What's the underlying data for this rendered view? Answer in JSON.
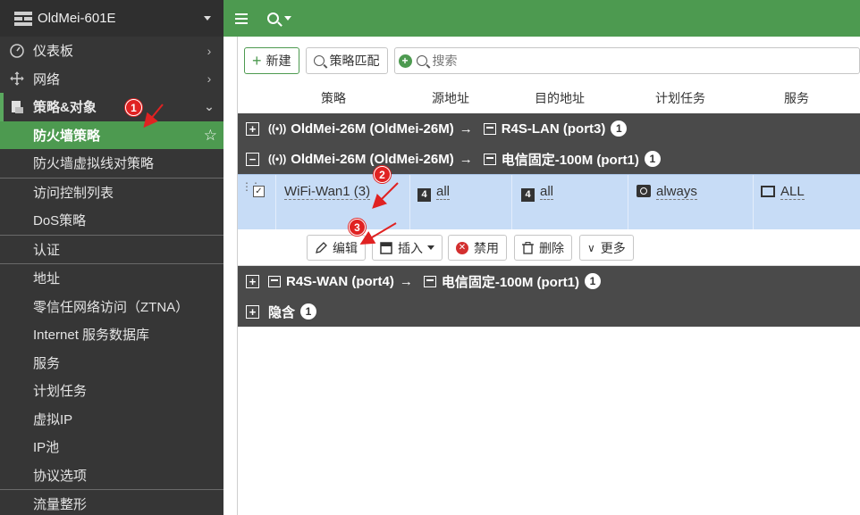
{
  "device": {
    "name": "OldMei-601E"
  },
  "sidebar": {
    "items": [
      {
        "label": "仪表板",
        "icon": "dashboard-icon"
      },
      {
        "label": "网络",
        "icon": "network-move-icon"
      },
      {
        "label": "策略&对象",
        "icon": "policy-icon"
      }
    ],
    "sub_items": [
      "防火墙策略",
      "防火墙虚拟线对策略",
      "访问控制列表",
      "DoS策略",
      "认证",
      "地址",
      "零信任网络访问（ZTNA）",
      "Internet 服务数据库",
      "服务",
      "计划任务",
      "虚拟IP",
      "IP池",
      "协议选项",
      "流量整形"
    ]
  },
  "toolbar": {
    "new_label": "新建",
    "policy_match_label": "策略匹配",
    "search_placeholder": "搜索"
  },
  "columns": [
    "策略",
    "源地址",
    "目的地址",
    "计划任务",
    "服务"
  ],
  "groups": [
    {
      "expand": "+",
      "src": "OldMei-26M (OldMei-26M)",
      "arrow": "→",
      "dst": "R4S-LAN (port3)",
      "count": "1"
    },
    {
      "expand": "−",
      "src": "OldMei-26M (OldMei-26M)",
      "arrow": "→",
      "dst": "电信固定-100M (port1)",
      "count": "1"
    },
    {
      "expand": "+",
      "src": "R4S-WAN (port4)",
      "arrow": "→",
      "dst": "电信固定-100M (port1)",
      "count": "1"
    },
    {
      "expand": "+",
      "label": "隐含",
      "count": "1"
    }
  ],
  "policy_row": {
    "name": "WiFi-Wan1 (3)",
    "source": "all",
    "destination": "all",
    "schedule": "always",
    "service": "ALL"
  },
  "actions": {
    "edit": "编辑",
    "insert": "插入",
    "disable": "禁用",
    "delete": "删除",
    "more": "更多"
  },
  "annotations": {
    "step1": "1",
    "step2": "2",
    "step3": "3"
  },
  "colors": {
    "accent": "#4d9a50",
    "sidebar": "#363636",
    "group_row": "#4a4a4a",
    "selected_row": "#c7dcf6",
    "annotation": "#e02222"
  }
}
